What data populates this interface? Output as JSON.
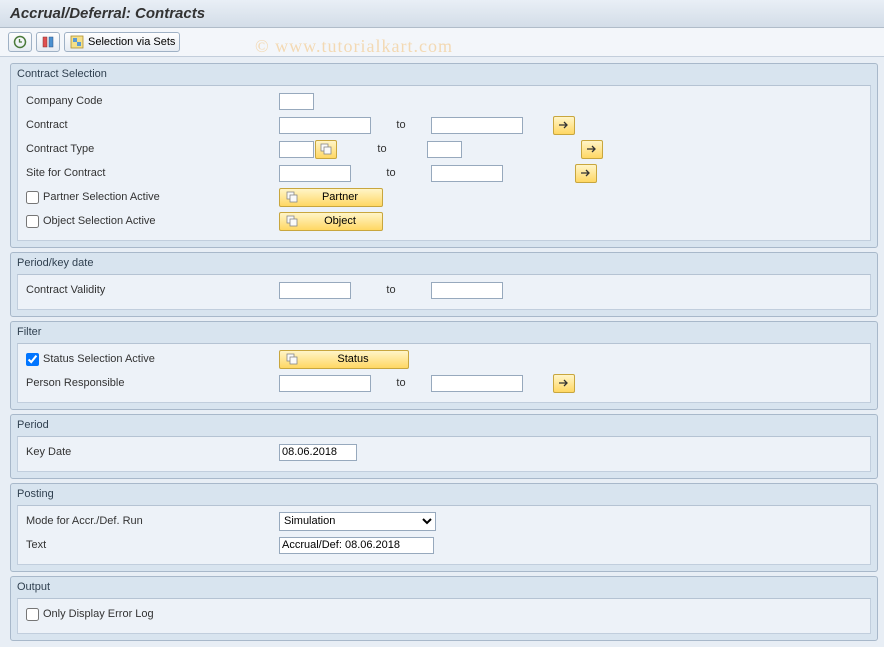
{
  "title": "Accrual/Deferral: Contracts",
  "toolbar": {
    "selection_via_sets": "Selection via Sets"
  },
  "watermark": "© www.tutorialkart.com",
  "groups": {
    "contract_selection": {
      "title": "Contract Selection",
      "company_code": "Company Code",
      "contract": "Contract",
      "contract_type": "Contract Type",
      "site": "Site for Contract",
      "partner_sel": "Partner Selection Active",
      "object_sel": "Object Selection Active",
      "to": "to",
      "partner_btn": "Partner",
      "object_btn": "Object"
    },
    "period_key": {
      "title": "Period/key date",
      "validity": "Contract Validity",
      "to": "to"
    },
    "filter": {
      "title": "Filter",
      "status_sel": "Status Selection Active",
      "status_btn": "Status",
      "person": "Person Responsible",
      "to": "to"
    },
    "period": {
      "title": "Period",
      "key_date": "Key Date",
      "key_date_val": "08.06.2018"
    },
    "posting": {
      "title": "Posting",
      "mode": "Mode for Accr./Def. Run",
      "mode_val": "Simulation",
      "text": "Text",
      "text_val": "Accrual/Def: 08.06.2018"
    },
    "output": {
      "title": "Output",
      "err_log": "Only Display Error Log"
    }
  }
}
